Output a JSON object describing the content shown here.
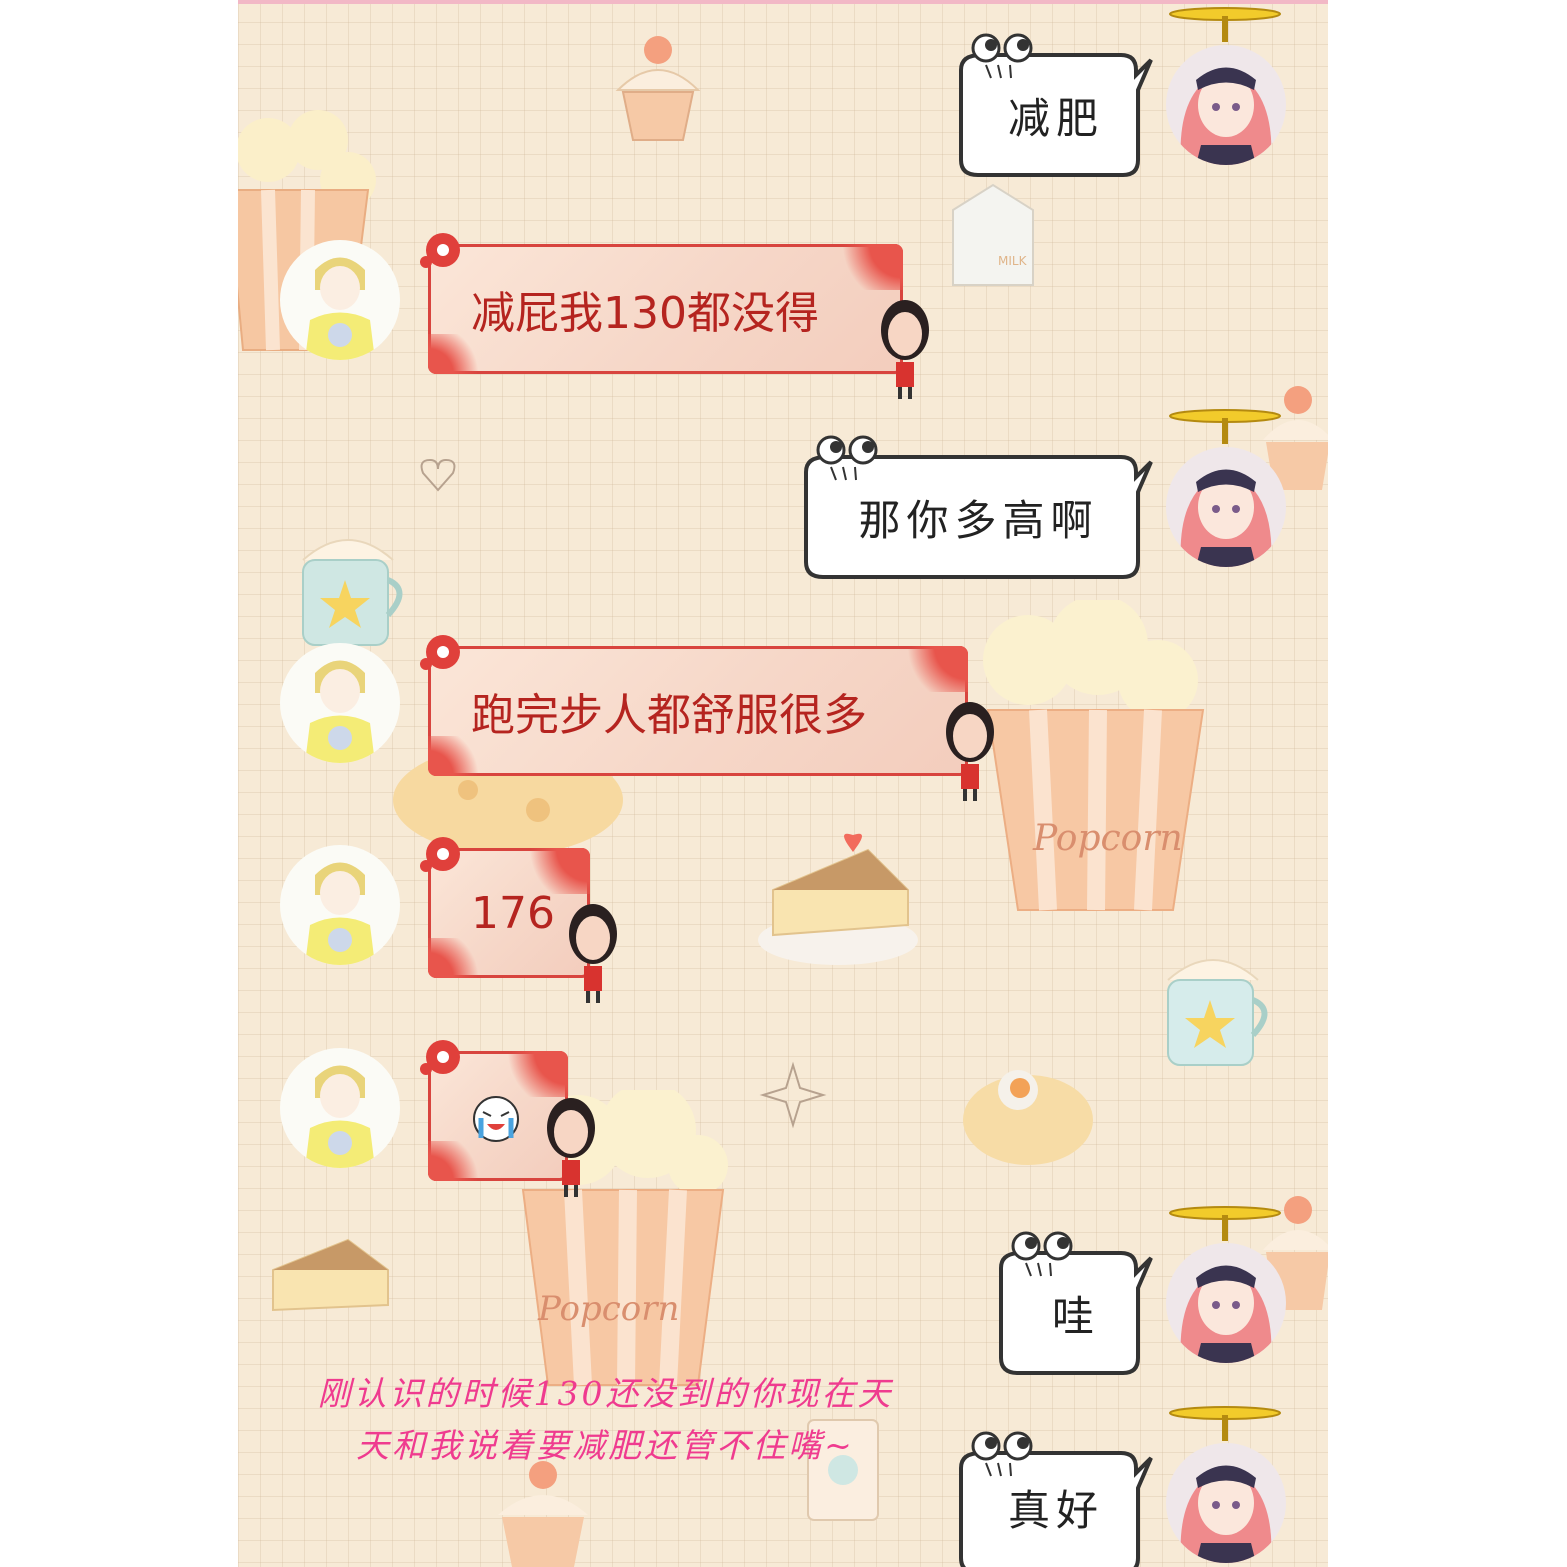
{
  "messages": [
    {
      "side": "right",
      "text": "减肥"
    },
    {
      "side": "left",
      "text": "减屁我130都没得"
    },
    {
      "side": "right",
      "text": "那你多高啊"
    },
    {
      "side": "left",
      "text": "跑完步人都舒服很多"
    },
    {
      "side": "left",
      "text": "176"
    },
    {
      "side": "left",
      "sticker": "crying-face-sticker"
    },
    {
      "side": "right",
      "text": "哇"
    },
    {
      "side": "right",
      "text": "真好"
    }
  ],
  "background_labels": {
    "popcorn": "Popcorn"
  },
  "caption": {
    "line1": "刚认识的时候130还没到的你现在天",
    "line2": "天和我说着要减肥还管不住嘴~"
  },
  "colors": {
    "background": "#f7ead6",
    "left_bubble_border": "#d8443e",
    "left_bubble_text": "#b5241f",
    "right_bubble_text": "#222222",
    "caption_pink": "#ef3b8f"
  }
}
